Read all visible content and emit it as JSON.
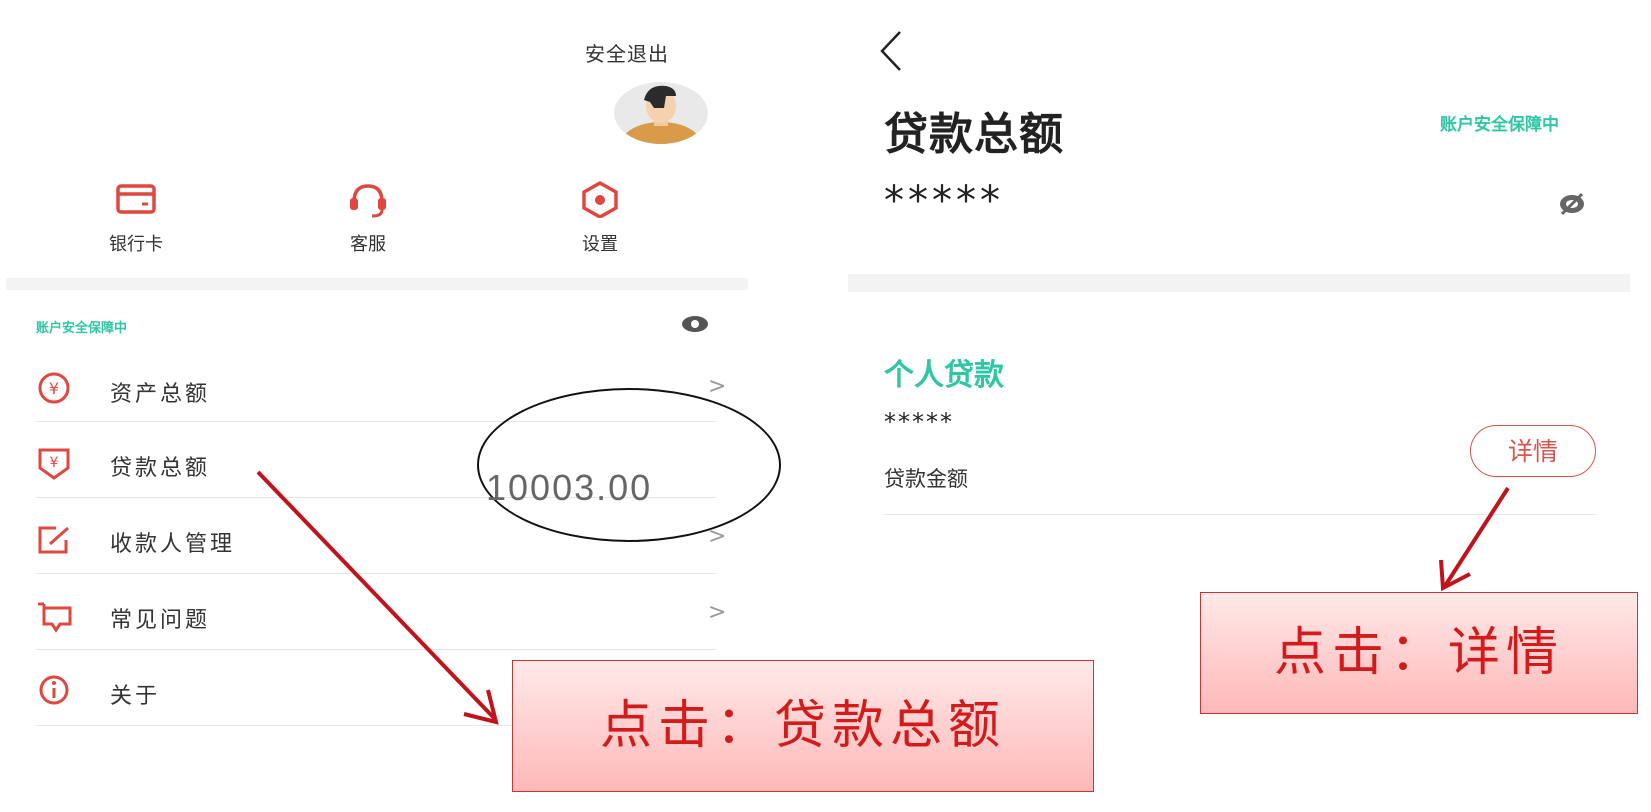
{
  "left": {
    "logout": "安全退出",
    "quick_actions": [
      {
        "label": "银行卡",
        "icon": "bank-card-icon"
      },
      {
        "label": "客服",
        "icon": "headset-icon"
      },
      {
        "label": "设置",
        "icon": "settings-icon"
      }
    ],
    "secure_text": "账户安全保障中",
    "menu": [
      {
        "label": "资产总额",
        "icon": "yuan-circle-icon"
      },
      {
        "label": "贷款总额",
        "icon": "loan-icon"
      },
      {
        "label": "收款人管理",
        "icon": "edit-box-icon"
      },
      {
        "label": "常见问题",
        "icon": "chat-bubble-icon"
      },
      {
        "label": "关于",
        "icon": "info-icon"
      }
    ],
    "arrow": ">",
    "loan_amount": "10003.00"
  },
  "right": {
    "title": "贷款总额",
    "secure_text": "账户安全保障中",
    "masked_total": "*****",
    "section_title": "个人贷款",
    "masked_loan": "*****",
    "loan_label": "贷款金额",
    "detail_button": "详情"
  },
  "callouts": {
    "click_loan": "点击：贷款总额",
    "click_detail": "点击：详情"
  },
  "colors": {
    "accent_red": "#e0473f",
    "secure_green": "#2fc6a4",
    "callout_text": "#d21b1b"
  }
}
